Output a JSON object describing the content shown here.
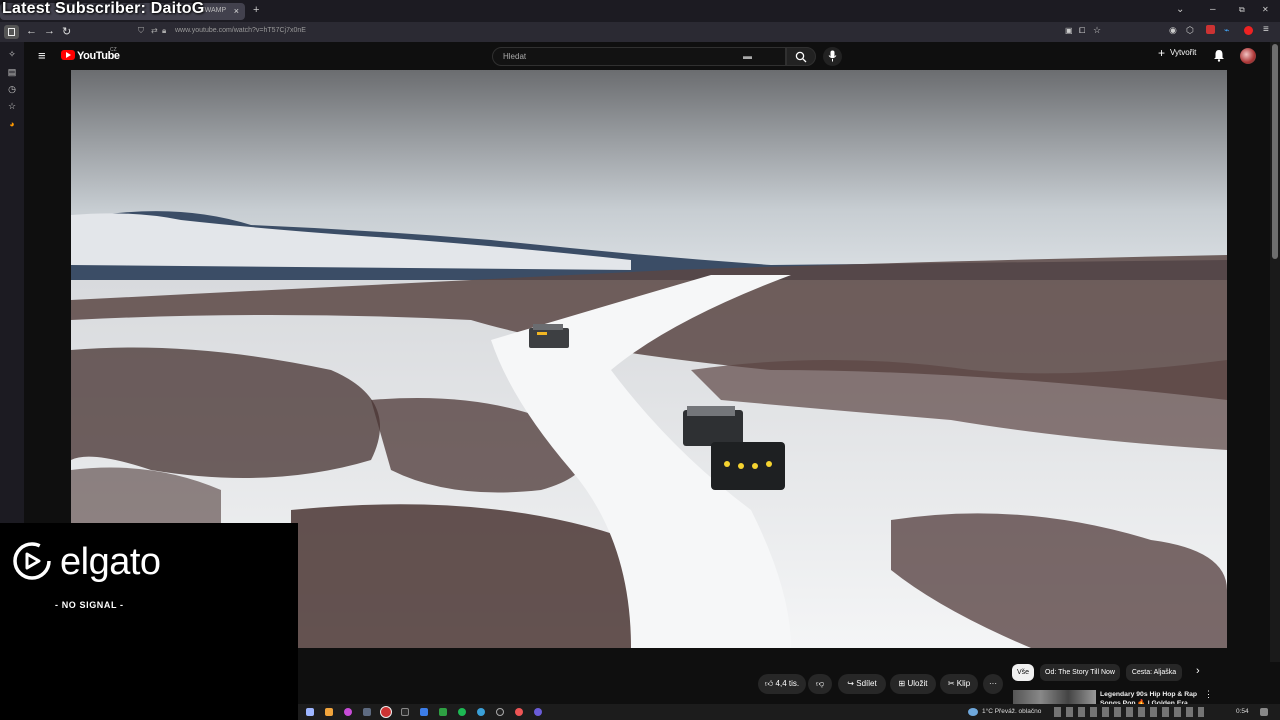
{
  "overlay": {
    "subscriber_text": "Latest Subscriber: DaitoG"
  },
  "browser": {
    "tab_title": "SWAMP",
    "tab_close": "×",
    "new_tab": "+",
    "url": "www.youtube.com/watch?v=hT57Cj7x0nE",
    "window_controls": [
      "⌄",
      "–",
      "⧉",
      "✕"
    ]
  },
  "youtube": {
    "logo_text": "YouTube",
    "country_code": "CZ",
    "search_placeholder": "Hledat",
    "create_label": "Vytvořit"
  },
  "elgato": {
    "logo_text": "elgato",
    "signal_text": "- NO SIGNAL -"
  },
  "actions": {
    "like_count": "4,4 tis.",
    "share_label": "Sdílet",
    "save_label": "Uložit",
    "clip_label": "Klip",
    "more_label": "···"
  },
  "chips": [
    "Vše",
    "Od: The Story Till Now",
    "Cesta: Aljaška"
  ],
  "recommended": {
    "title": "Legendary 90s Hip Hop & Rap Songs Pop 🔥 | Golden Era"
  },
  "taskbar": {
    "weather": "1°C  Převáž. oblačno",
    "clock": "0:54"
  }
}
